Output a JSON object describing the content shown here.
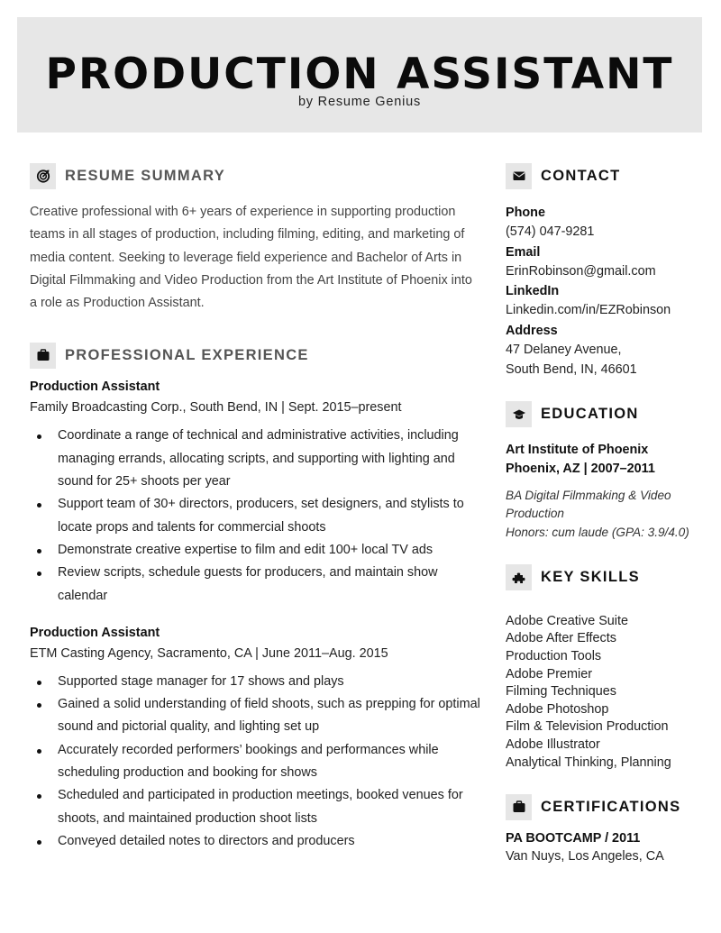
{
  "header": {
    "title": "PRODUCTION ASSISTANT",
    "byline": "by Resume Genius"
  },
  "summary": {
    "heading": "RESUME SUMMARY",
    "icon": "target-icon",
    "text": "Creative professional with 6+ years of experience in supporting production teams in all stages of production, including filming, editing, and marketing of media content. Seeking to leverage field experience and Bachelor of Arts in Digital Filmmaking and Video Production from the Art Institute of Phoenix into a role as Production Assistant."
  },
  "experience": {
    "heading": "PROFESSIONAL EXPERIENCE",
    "icon": "briefcase-icon",
    "jobs": [
      {
        "title": "Production Assistant",
        "meta": "Family Broadcasting Corp., South Bend, IN | Sept. 2015–present",
        "bullets": [
          "Coordinate a range of technical and administrative activities, including managing errands, allocating scripts, and supporting with lighting and sound for 25+ shoots per year",
          "Support team of 30+ directors, producers, set designers, and stylists to locate props and talents for commercial shoots",
          "Demonstrate creative expertise to film and edit 100+ local TV ads",
          "Review scripts, schedule guests for producers, and maintain show calendar"
        ]
      },
      {
        "title": "Production Assistant",
        "meta": "ETM Casting Agency, Sacramento, CA | June 2011–Aug. 2015",
        "bullets": [
          "Supported stage manager for 17 shows and plays",
          "Gained a solid understanding of field shoots, such as prepping for optimal sound and pictorial quality, and lighting set up",
          "Accurately recorded performers’ bookings and performances while scheduling production and booking for shows",
          "Scheduled and participated in production meetings, booked venues for shoots, and maintained production shoot lists",
          "Conveyed detailed notes to directors and producers"
        ]
      }
    ]
  },
  "contact": {
    "heading": "CONTACT",
    "icon": "envelope-icon",
    "phone_label": "Phone",
    "phone": "(574) 047-9281",
    "email_label": "Email",
    "email": "ErinRobinson@gmail.com",
    "linkedin_label": "LinkedIn",
    "linkedin": "Linkedin.com/in/EZRobinson",
    "address_label": "Address",
    "address_line1": "47 Delaney Avenue,",
    "address_line2": "South Bend, IN, 46601"
  },
  "education": {
    "heading": "EDUCATION",
    "icon": "graduation-cap-icon",
    "school": "Art Institute of Phoenix",
    "location_dates": "Phoenix, AZ | 2007–2011",
    "degree": "BA Digital Filmmaking & Video Production",
    "honors": "Honors: cum laude (GPA: 3.9/4.0)"
  },
  "skills": {
    "heading": "KEY SKILLS",
    "icon": "puzzle-piece-icon",
    "items": [
      "Adobe Creative Suite",
      "Adobe After Effects",
      "Production Tools",
      "Adobe Premier",
      "Filming Techniques",
      "Adobe Photoshop",
      "Film & Television Production",
      "Adobe Illustrator",
      "Analytical Thinking, Planning"
    ]
  },
  "certifications": {
    "heading": "CERTIFICATIONS",
    "icon": "briefcase-icon",
    "name": "PA BOOTCAMP / 2011",
    "location": "Van Nuys, Los Angeles, CA"
  }
}
